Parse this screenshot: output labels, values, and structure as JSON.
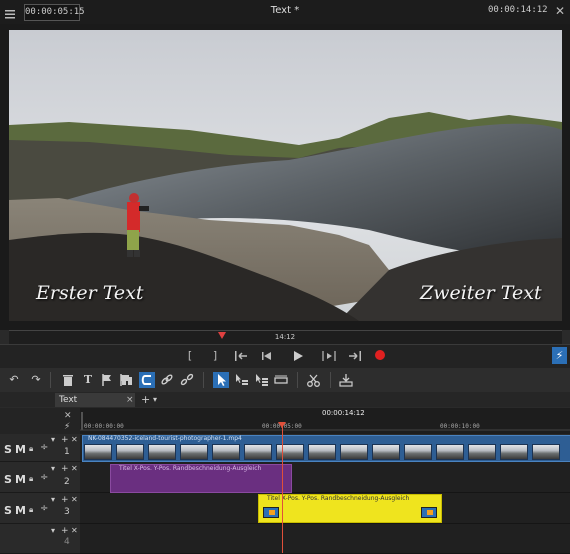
{
  "topbar": {
    "timecode_left": "00:00:05:15",
    "title": "Text *",
    "timecode_right": "00:00:14:12"
  },
  "preview": {
    "overlay_left": "Erster Text",
    "overlay_right": "Zweiter Text"
  },
  "position": {
    "time": "14:12"
  },
  "transport": {
    "buttons": [
      "[",
      "]",
      "⇤",
      "⏮",
      "▶",
      "⇥",
      "⇥"
    ]
  },
  "tabs": {
    "active": "Text",
    "close": "×",
    "add": "+",
    "menu": "▾"
  },
  "ruler": {
    "time": "00:00:14:12",
    "tick_0": "00:00:00:00",
    "tick_5": "00:00:05:00",
    "tick_10": "00:00:10:00"
  },
  "tracks": [
    {
      "number": "1",
      "s": "S",
      "m": "M"
    },
    {
      "number": "2",
      "s": "S",
      "m": "M"
    },
    {
      "number": "3",
      "s": "S",
      "m": "M"
    },
    {
      "number": "4"
    }
  ],
  "clips": {
    "video_label": "NK-084470352-iceland-tourist-photographer-1.mp4",
    "title1_label": "Titel  X-Pos.  Y-Pos.  Randbeschneidung-Ausgleich",
    "title2_label": "Titel  X-Pos.  Y-Pos.  Randbeschneidung-Ausgleich"
  },
  "colors": {
    "accent": "#2b6fb6",
    "record": "#e02020",
    "title_clip_1": "#6a2f80",
    "title_clip_2": "#efe41e",
    "playhead": "#e0503a"
  },
  "icons": [
    "menu-icon",
    "close-icon",
    "undo-icon",
    "redo-icon",
    "trash-icon",
    "text-icon",
    "flag-icon",
    "scissors-icon",
    "link-icon",
    "cursor-icon",
    "flash-icon",
    "record-icon"
  ]
}
